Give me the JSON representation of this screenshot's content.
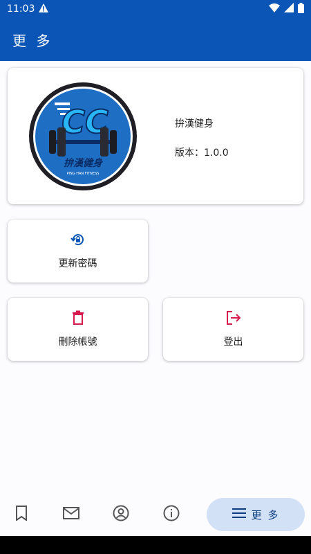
{
  "status": {
    "time": "11:03"
  },
  "app_bar": {
    "title": "更 多"
  },
  "info": {
    "app_name": "拚漢健身",
    "version": "版本：1.0.0",
    "logo_text": "拚漢健身",
    "logo_subtext": "PING HAN FITNESS",
    "logo_monogram": "CC"
  },
  "tiles": {
    "change_password": "更新密碼",
    "delete_account": "刪除帳號",
    "logout": "登出"
  },
  "nav": {
    "active_label": "更 多",
    "items": [
      "bookmark-icon",
      "mail-icon",
      "account-icon",
      "info-icon",
      "menu-icon"
    ]
  },
  "colors": {
    "primary": "#0a55b5",
    "danger": "#d81b4f",
    "nav_active_bg": "#d3e1f6"
  }
}
